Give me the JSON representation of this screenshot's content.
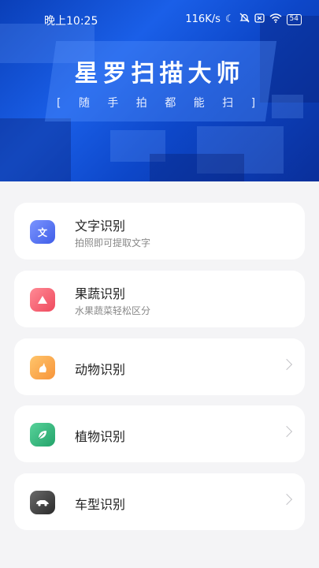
{
  "status_bar": {
    "time": "晚上10:25",
    "network_speed": "116K/s",
    "battery": "54"
  },
  "banner": {
    "title": "星罗扫描大师",
    "subtitle": "[ 随 手 拍 都 能 扫 ]"
  },
  "features": [
    {
      "title": "文字识别",
      "subtitle": "拍照即可提取文字",
      "icon": "text-icon",
      "icon_glyph": "文",
      "color": "#4a6cf7"
    },
    {
      "title": "果蔬识别",
      "subtitle": "水果蔬菜轻松区分",
      "icon": "fruit-icon",
      "icon_glyph": "",
      "color": "#f0566a"
    },
    {
      "title": "动物识别",
      "subtitle": "",
      "icon": "animal-icon",
      "icon_glyph": "",
      "color": "#f7a74a"
    },
    {
      "title": "植物识别",
      "subtitle": "",
      "icon": "plant-icon",
      "icon_glyph": "",
      "color": "#2fb07a"
    },
    {
      "title": "车型识别",
      "subtitle": "",
      "icon": "car-icon",
      "icon_glyph": "",
      "color": "#3a3a3a"
    }
  ],
  "colors": {
    "banner_primary": "#1a5fe8",
    "background": "#f4f4f6"
  }
}
